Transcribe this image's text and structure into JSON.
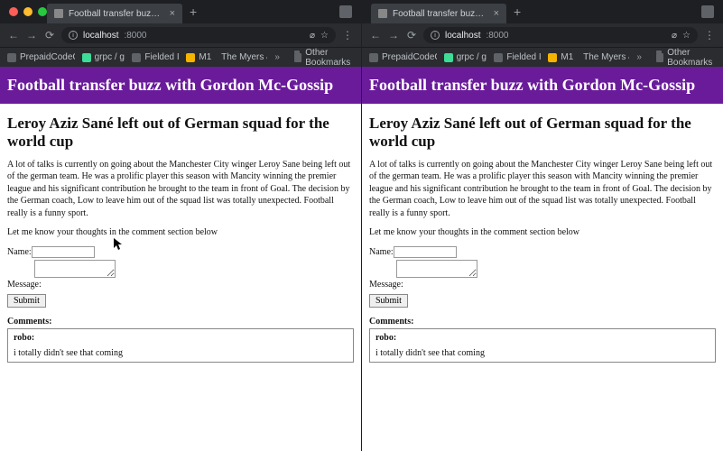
{
  "browser": {
    "tab_title": "Football transfer buzz with G",
    "nav": {
      "back": "←",
      "forward": "→",
      "reload": "⟳",
      "info_glyph": "i",
      "url_host": "localhost",
      "url_path": ":8000",
      "q_glyph": "⌀",
      "star_glyph": "☆",
      "menu_glyph": "⋮"
    },
    "bookmarks": [
      "PrepaidCodeCenter…",
      "grpc / grpc.io",
      "Fielded Issues",
      "The Myers & Briggs…"
    ],
    "bookmarks_m1_prefix": "M1",
    "bookmarks_overflow": "»",
    "other_bookmarks": "Other Bookmarks"
  },
  "page": {
    "banner_title": "Football transfer buzz with Gordon Mc-Gossip",
    "article_title": "Leroy Aziz Sané left out of German squad for the world cup",
    "body_p1": "A lot of talks is currently on going about the Manchester City winger Leroy Sane being left out of the german team. He was a prolific player this season with Mancity winning the premier league and his significant contribution he brought to the team in front of Goal. The decision by the German coach, Low to leave him out of the squad list was totally unexpected. Football really is a funny sport.",
    "body_p2": "Let me know your thoughts in the comment section below",
    "form": {
      "name_label": "Name:",
      "name_value": "",
      "message_label": "Message:",
      "message_value": "",
      "submit_label": "Submit"
    },
    "comments": {
      "heading": "Comments:",
      "items": [
        {
          "author": "robo:",
          "body": "i totally didn't see that coming"
        }
      ]
    }
  }
}
